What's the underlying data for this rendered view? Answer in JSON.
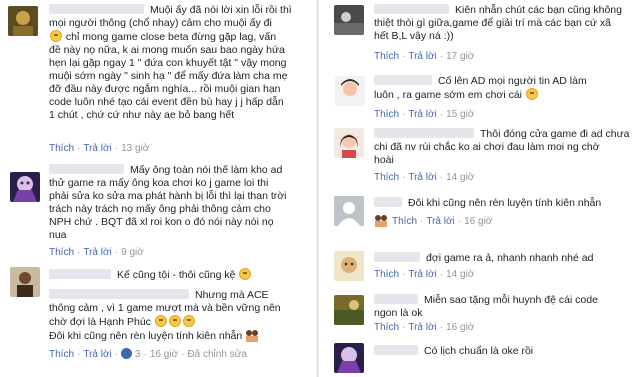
{
  "colors": {
    "link": "#4267b2",
    "meta": "#90949c",
    "divider": "#e9ebee",
    "avatar_placeholder": "#bec3c9"
  },
  "left": {
    "c1": {
      "lines": [
        "Muội ấy đã nói lời xin lỗi rồi thì",
        "mọi người thông (chổ nhay) cảm cho muội ấy đi",
        "chỉ mong game close beta đừng gặp lag, vấn",
        "đề này nọ nữa, k ai mong muốn sau bao ngày hứa",
        "hẹn lại gặp ngay 1 \" đứa con khuyết tật \" vậy mong",
        "muội sớm ngày \" sinh hạ \" để mấy đứa làm cha mẹ",
        "đỡ đầu này được ngắm nghía... rồi muội gian hạn",
        "code luôn nhé tạo cái event đền bù hay j j hấp dẫn",
        "1 chút , chứ cứ như này ae bỏ bang hết"
      ],
      "actions": {
        "like": "Thích",
        "reply": "Trả lời",
        "time": "13 giờ"
      }
    },
    "c2": {
      "lines": [
        "Mấy ông toàn nói thế làm kho ad",
        "thử game ra mấy ông koa chơi ko j game loi thi",
        "phải sửa ko sửa ma phát hành bị lỗi thì lại than trời",
        "trách này trách nọ mấy ông phải thông cảm cho",
        "NPH chứ . BQT đã xl roi kon o đó nói này nói nọ",
        "nua"
      ],
      "actions": {
        "like": "Thích",
        "reply": "Trả lời",
        "time": "9 giờ"
      }
    },
    "c3": {
      "line1": "Kế cũng tội - thôi cũng kệ",
      "lines": [
        "Nhưng mà ACE",
        "thông cảm , vì 1 game mượt mà và bền vững nên",
        "chờ đợi là Hạnh Phúc",
        "Đôi khi cũng nên rèn luyện tính kiên nhẫn"
      ],
      "actions": {
        "like": "Thích",
        "reply": "Trả lời",
        "likes": "3",
        "time": "16 giờ",
        "edited": "Đã chỉnh sửa"
      }
    }
  },
  "right": {
    "r1": {
      "lines": [
        "Kiên nhẫn chút các bạn cũng không",
        "thiệt thòi gì giữa,game để giải trí mà các bạn cứ xã",
        "hết B,L vậy ná :))"
      ],
      "actions": {
        "like": "Thích",
        "reply": "Trả lời",
        "time": "17 giờ"
      }
    },
    "r2": {
      "lines": [
        "Cố lên AD mọi người tin AD làm",
        "luôn , ra game sớm em chơi cái"
      ],
      "actions": {
        "like": "Thích",
        "reply": "Trả lời",
        "time": "15 giờ"
      }
    },
    "r3": {
      "lines": [
        "Thôi đóng cửa game đi ad chưa",
        "chi đã nv rùi chắc ko ai chơi đau làm moi ng chờ",
        "hoài"
      ],
      "actions": {
        "like": "Thích",
        "reply": "Trả lời",
        "time": "14 giờ"
      }
    },
    "r4": {
      "line": "Đôi khi cũng nên rèn luyện tính kiên nhẫn",
      "actions": {
        "like": "Thích",
        "reply": "Trả lời",
        "time": "16 giờ"
      }
    },
    "r5": {
      "line": "đợi game ra ả, nhanh nhanh nhé ad",
      "actions": {
        "like": "Thích",
        "reply": "Trả lời",
        "time": "14 giờ"
      }
    },
    "r6": {
      "lines": [
        "Miễn sao tặng mỗi huynh đệ cái code",
        "ngon là ok"
      ],
      "actions": {
        "like": "Thích",
        "reply": "Trả lời",
        "time": "16 giờ"
      }
    },
    "r7": {
      "line": "Có lịch chuẩn là oke rồi"
    }
  }
}
